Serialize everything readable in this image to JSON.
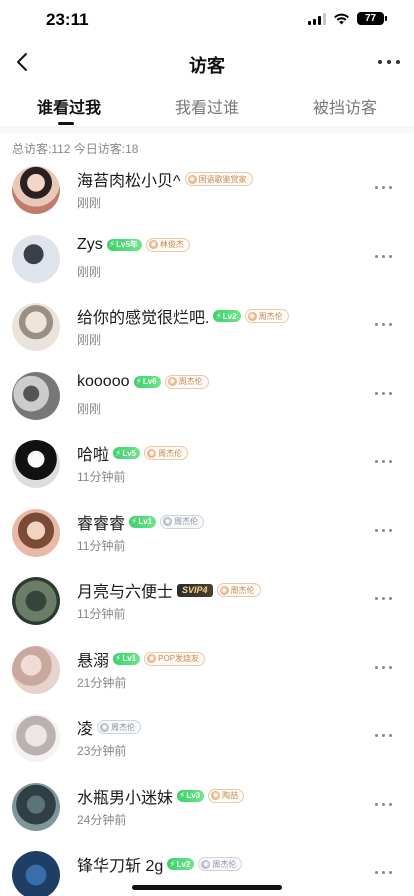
{
  "status": {
    "time": "23:11",
    "battery": "77"
  },
  "nav": {
    "title": "访客"
  },
  "tabs": [
    {
      "label": "谁看过我",
      "active": true
    },
    {
      "label": "我看过谁",
      "active": false
    },
    {
      "label": "被挡访客",
      "active": false
    }
  ],
  "summary": "总访客:112 今日访客:18",
  "visitors": [
    {
      "name": "海苔肉松小贝^",
      "time": "刚刚",
      "level": "",
      "tag": "国语歌鉴赏家",
      "tag_style": "warm"
    },
    {
      "name": "Zys",
      "time": "刚刚",
      "level": "Lv5年",
      "tag": "林俊杰",
      "tag_style": "warm"
    },
    {
      "name": "给你的感觉很烂吧.",
      "time": "刚刚",
      "level": "Lv2",
      "tag": "周杰伦",
      "tag_style": "warm"
    },
    {
      "name": " kooooo",
      "time": "刚刚",
      "level": "Lv6",
      "tag": "周杰伦",
      "tag_style": "warm"
    },
    {
      "name": "哈啦",
      "time": "11分钟前",
      "level": "Lv5",
      "tag": "周杰伦",
      "tag_style": "warm"
    },
    {
      "name": "睿睿睿",
      "time": "11分钟前",
      "level": "Lv1",
      "tag": "周杰伦",
      "tag_style": "grey"
    },
    {
      "name": "月亮与六便士",
      "time": "11分钟前",
      "level": "",
      "svip": "SVIP4",
      "tag": "周杰伦",
      "tag_style": "warm"
    },
    {
      "name": "悬溺",
      "time": "21分钟前",
      "level": "Lv1",
      "tag": "POP发烧友",
      "tag_style": "warm"
    },
    {
      "name": "凌",
      "time": "23分钟前",
      "level": "",
      "tag": "周杰伦",
      "tag_style": "grey"
    },
    {
      "name": "水瓶男小迷妹",
      "time": "24分钟前",
      "level": "Lv3",
      "tag": "陶喆",
      "tag_style": "warm"
    },
    {
      "name": "锋华刀斩 2g",
      "time": "",
      "level": "Lv2",
      "tag": "周杰伦",
      "tag_style": "grey"
    }
  ],
  "colors": {
    "level_badge": "#3ad16a",
    "tag_warm": "#c48a55",
    "tag_grey": "#8a93a3",
    "svip_gold": "#f2d48a"
  }
}
